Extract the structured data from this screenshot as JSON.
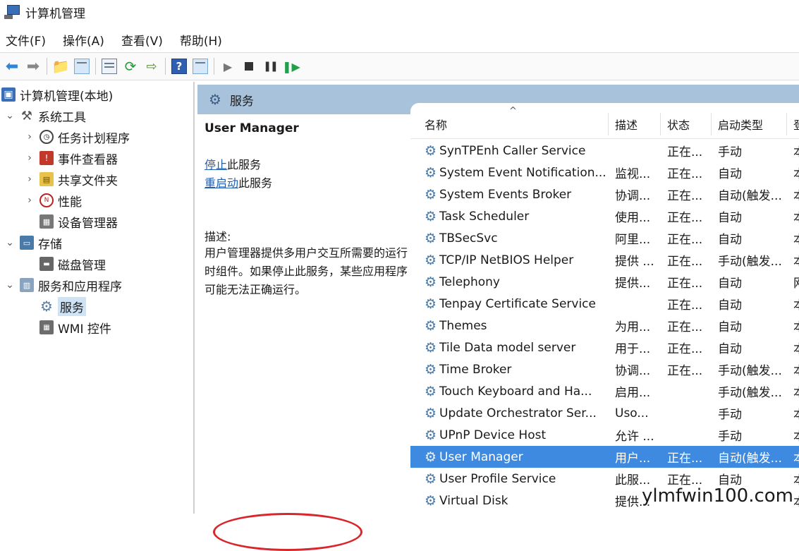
{
  "window": {
    "title": "计算机管理"
  },
  "menu": [
    "文件(F)",
    "操作(A)",
    "查看(V)",
    "帮助(H)"
  ],
  "toolbar": {
    "help_glyph": "?"
  },
  "tree": {
    "root": "计算机管理(本地)",
    "system_tools": "系统工具",
    "task_scheduler": "任务计划程序",
    "event_viewer": "事件查看器",
    "shared_folders": "共享文件夹",
    "performance": "性能",
    "device_manager": "设备管理器",
    "storage": "存储",
    "disk_management": "磁盘管理",
    "services_apps": "服务和应用程序",
    "services": "服务",
    "wmi": "WMI 控件"
  },
  "content": {
    "header_title": "服务",
    "selected_service": "User Manager",
    "stop_link": "停止",
    "stop_suffix": "此服务",
    "restart_link": "重启动",
    "restart_suffix": "此服务",
    "desc_label": "描述:",
    "desc_text": "用户管理器提供多用户交互所需要的运行时组件。如果停止此服务，某些应用程序可能无法正确运行。"
  },
  "columns": {
    "name": "名称",
    "desc": "描述",
    "status": "状态",
    "startup": "启动类型",
    "logon": "登"
  },
  "services": [
    {
      "name": "SynTPEnh Caller Service",
      "desc": "",
      "status": "正在...",
      "startup": "手动",
      "logon": "本"
    },
    {
      "name": "System Event Notification...",
      "desc": "监视...",
      "status": "正在...",
      "startup": "自动",
      "logon": "本"
    },
    {
      "name": "System Events Broker",
      "desc": "协调...",
      "status": "正在...",
      "startup": "自动(触发...",
      "logon": "本"
    },
    {
      "name": "Task Scheduler",
      "desc": "使用...",
      "status": "正在...",
      "startup": "自动",
      "logon": "本"
    },
    {
      "name": "TBSecSvc",
      "desc": "阿里...",
      "status": "正在...",
      "startup": "自动",
      "logon": "本"
    },
    {
      "name": "TCP/IP NetBIOS Helper",
      "desc": "提供 ...",
      "status": "正在...",
      "startup": "手动(触发...",
      "logon": "本"
    },
    {
      "name": "Telephony",
      "desc": "提供...",
      "status": "正在...",
      "startup": "自动",
      "logon": "网"
    },
    {
      "name": "Tenpay Certificate Service",
      "desc": "",
      "status": "正在...",
      "startup": "自动",
      "logon": "本"
    },
    {
      "name": "Themes",
      "desc": "为用...",
      "status": "正在...",
      "startup": "自动",
      "logon": "本"
    },
    {
      "name": "Tile Data model server",
      "desc": "用于...",
      "status": "正在...",
      "startup": "自动",
      "logon": "本"
    },
    {
      "name": "Time Broker",
      "desc": "协调...",
      "status": "正在...",
      "startup": "手动(触发...",
      "logon": "本"
    },
    {
      "name": "Touch Keyboard and Ha...",
      "desc": "启用...",
      "status": "",
      "startup": "手动(触发...",
      "logon": "本"
    },
    {
      "name": "Update Orchestrator Ser...",
      "desc": "Uso...",
      "status": "",
      "startup": "手动",
      "logon": "本"
    },
    {
      "name": "UPnP Device Host",
      "desc": "允许 ...",
      "status": "",
      "startup": "手动",
      "logon": "本"
    },
    {
      "name": "User Manager",
      "desc": "用户...",
      "status": "正在...",
      "startup": "自动(触发...",
      "logon": "本"
    },
    {
      "name": "User Profile Service",
      "desc": "此服...",
      "status": "正在...",
      "startup": "自动",
      "logon": "本"
    },
    {
      "name": "Virtual Disk",
      "desc": "提供...",
      "status": "",
      "startup": "",
      "logon": "本"
    }
  ],
  "selected_index": 14,
  "watermark": "ylmfwin100.com"
}
